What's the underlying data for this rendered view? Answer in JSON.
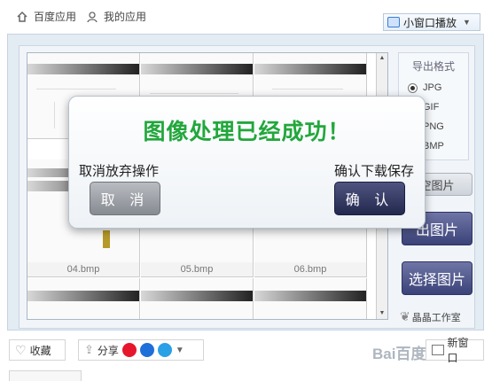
{
  "topnav": {
    "baidu_apps": "百度应用",
    "my_apps": "我的应用",
    "mini_player": "小窗口播放"
  },
  "thumbnails": [
    {
      "caption": ""
    },
    {
      "caption": ""
    },
    {
      "caption": ""
    },
    {
      "caption": ""
    },
    {
      "caption": ""
    },
    {
      "caption": ""
    },
    {
      "caption": "04.bmp"
    },
    {
      "caption": "05.bmp"
    },
    {
      "caption": "06.bmp"
    },
    {
      "caption": ""
    },
    {
      "caption": ""
    },
    {
      "caption": ""
    }
  ],
  "panel": {
    "format_title": "导出格式",
    "formats": [
      "JPG",
      "GIF",
      "PNG",
      "BMP"
    ],
    "selected_format": "JPG",
    "partial_button_1": "空图片",
    "partial_button_2": "出图片",
    "select_button": "选择图片",
    "studio": "晶晶工作室"
  },
  "dialog": {
    "title": "图像处理已经成功！",
    "left_text": "取消放弃操作",
    "right_text": "确认下载保存",
    "cancel_label": "取 消",
    "ok_label": "确 认"
  },
  "bottom": {
    "favorite": "收藏",
    "share": "分享",
    "new_window": "新窗口"
  },
  "watermark": "Bai百度"
}
